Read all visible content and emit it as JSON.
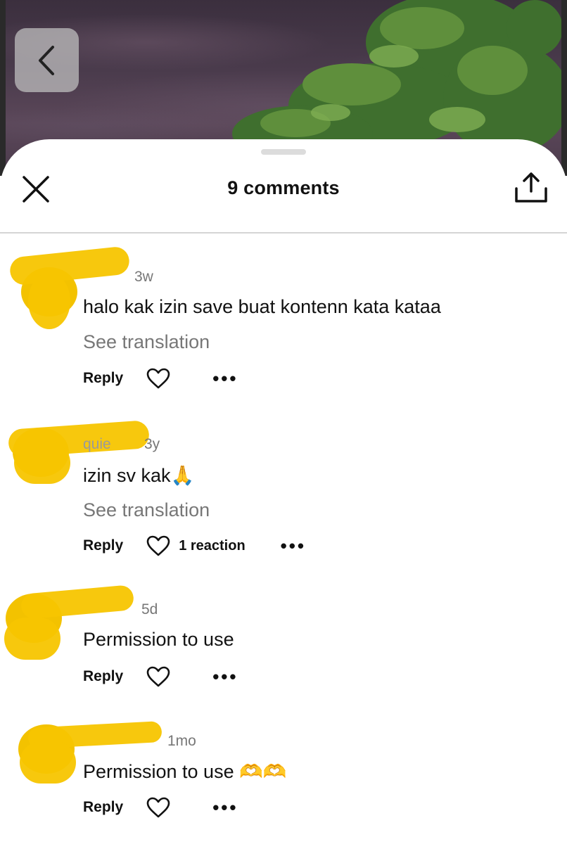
{
  "header": {
    "title": "9 comments"
  },
  "colors": {
    "scribble": "#f7c500",
    "muted_text": "#777777",
    "divider": "#d4d4d4"
  },
  "comments": [
    {
      "time": "3w",
      "text": "halo kak izin save buat kontenn kata kataa",
      "see_translation": "See translation",
      "reply": "Reply",
      "reaction": "",
      "more": "•••"
    },
    {
      "username": "quie",
      "time": "3y",
      "text": "izin sv kak🙏",
      "see_translation": "See translation",
      "reply": "Reply",
      "reaction": "1 reaction",
      "more": "•••"
    },
    {
      "time": "5d",
      "text": "Permission to use",
      "reply": "Reply",
      "reaction": "",
      "more": "•••"
    },
    {
      "time": "1mo",
      "text": "Permission to use 🫶🫶",
      "reply": "Reply",
      "reaction": "",
      "more": "•••"
    }
  ],
  "icons": {
    "back": "chevron-left-icon",
    "close": "close-icon",
    "share": "share-icon",
    "like": "heart-icon"
  }
}
